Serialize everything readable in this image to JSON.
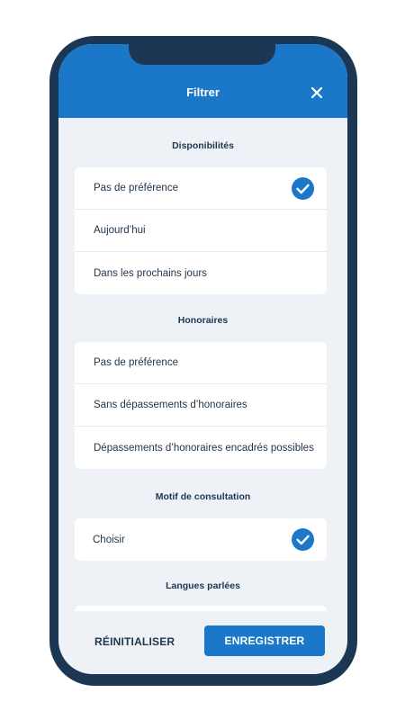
{
  "header": {
    "title": "Filtrer",
    "close_icon": "close-icon"
  },
  "sections": [
    {
      "title": "Disponibilités",
      "options": [
        {
          "label": "Pas de préférence",
          "selected": true
        },
        {
          "label": "Aujourd’hui",
          "selected": false
        },
        {
          "label": "Dans les prochains jours",
          "selected": false
        }
      ]
    },
    {
      "title": "Honoraires",
      "options": [
        {
          "label": "Pas de préférence",
          "selected": false
        },
        {
          "label": "Sans dépassements d’honoraires",
          "selected": false
        },
        {
          "label": "Dépassements d’honoraires encadrés possibles",
          "selected": false
        }
      ]
    },
    {
      "title": "Motif de consultation",
      "options": [
        {
          "label": "Choisir",
          "selected": true
        }
      ]
    },
    {
      "title": "Langues parlées",
      "options": []
    }
  ],
  "footer": {
    "reset_label": "RÉINITIALISER",
    "save_label": "ENREGISTRER"
  },
  "colors": {
    "accent": "#1b78c8",
    "frame": "#1b3754",
    "background": "#eef2f6",
    "text": "#22364b"
  }
}
